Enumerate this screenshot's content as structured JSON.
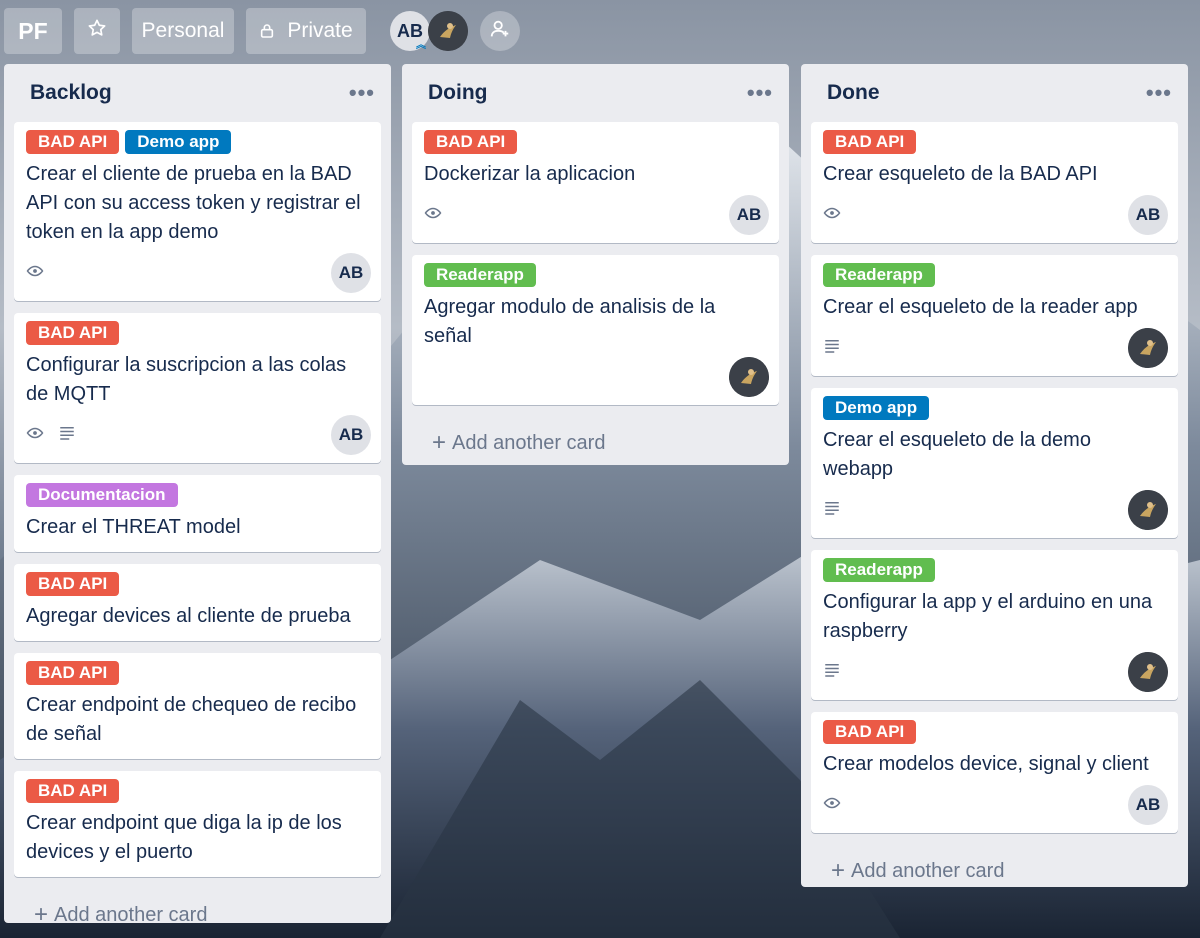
{
  "header": {
    "board_initials": "PF",
    "star_icon": "star-icon",
    "team": "Personal",
    "visibility": "Private",
    "members": [
      {
        "initials": "AB",
        "type": "initials"
      },
      {
        "initials": "",
        "type": "photo"
      }
    ],
    "invite_icon": "add-member-icon"
  },
  "colors": {
    "red": "#eb5a46",
    "blue": "#0079bf",
    "green": "#61bd4f",
    "purple": "#c377e0"
  },
  "lists": [
    {
      "title": "Backlog",
      "menu": "•••",
      "add_card": "Add another card",
      "cards": [
        {
          "labels": [
            {
              "text": "BAD API",
              "color": "red"
            },
            {
              "text": "Demo app",
              "color": "blue"
            }
          ],
          "text": "Crear el cliente de prueba en la BAD API con su access token y registrar el token en la app demo",
          "badges": [
            "eye-icon"
          ],
          "member": "AB"
        },
        {
          "labels": [
            {
              "text": "BAD API",
              "color": "red"
            }
          ],
          "text": "Configurar la suscripcion a las colas de MQTT",
          "badges": [
            "eye-icon",
            "description-icon"
          ],
          "member": "AB"
        },
        {
          "labels": [
            {
              "text": "Documentacion",
              "color": "purple"
            }
          ],
          "text": "Crear el THREAT model",
          "badges": [],
          "member": ""
        },
        {
          "labels": [
            {
              "text": "BAD API",
              "color": "red"
            }
          ],
          "text": "Agregar devices al cliente de prueba",
          "badges": [],
          "member": ""
        },
        {
          "labels": [
            {
              "text": "BAD API",
              "color": "red"
            }
          ],
          "text": "Crear endpoint de chequeo de recibo de señal",
          "badges": [],
          "member": ""
        },
        {
          "labels": [
            {
              "text": "BAD API",
              "color": "red"
            }
          ],
          "text": "Crear endpoint que diga la ip de los devices y el puerto",
          "badges": [],
          "member": ""
        }
      ]
    },
    {
      "title": "Doing",
      "menu": "•••",
      "add_card": "Add another card",
      "cards": [
        {
          "labels": [
            {
              "text": "BAD API",
              "color": "red"
            }
          ],
          "text": "Dockerizar la aplicacion",
          "badges": [
            "eye-icon"
          ],
          "member": "AB"
        },
        {
          "labels": [
            {
              "text": "Readerapp",
              "color": "green"
            }
          ],
          "text": "Agregar modulo de analisis de la señal",
          "badges": [],
          "member": "photo"
        }
      ]
    },
    {
      "title": "Done",
      "menu": "•••",
      "add_card": "Add another card",
      "cards": [
        {
          "labels": [
            {
              "text": "BAD API",
              "color": "red"
            }
          ],
          "text": "Crear esqueleto de la BAD API",
          "badges": [
            "eye-icon"
          ],
          "member": "AB"
        },
        {
          "labels": [
            {
              "text": "Readerapp",
              "color": "green"
            }
          ],
          "text": "Crear el esqueleto de la reader app",
          "badges": [
            "description-icon"
          ],
          "member": "photo"
        },
        {
          "labels": [
            {
              "text": "Demo app",
              "color": "blue"
            }
          ],
          "text": "Crear el esqueleto de la demo webapp",
          "badges": [
            "description-icon"
          ],
          "member": "photo"
        },
        {
          "labels": [
            {
              "text": "Readerapp",
              "color": "green"
            }
          ],
          "text": "Configurar la app y el arduino en una raspberry",
          "badges": [
            "description-icon"
          ],
          "member": "photo"
        },
        {
          "labels": [
            {
              "text": "BAD API",
              "color": "red"
            }
          ],
          "text": "Crear modelos device, signal y client",
          "badges": [
            "eye-icon"
          ],
          "member": "AB"
        }
      ]
    }
  ]
}
